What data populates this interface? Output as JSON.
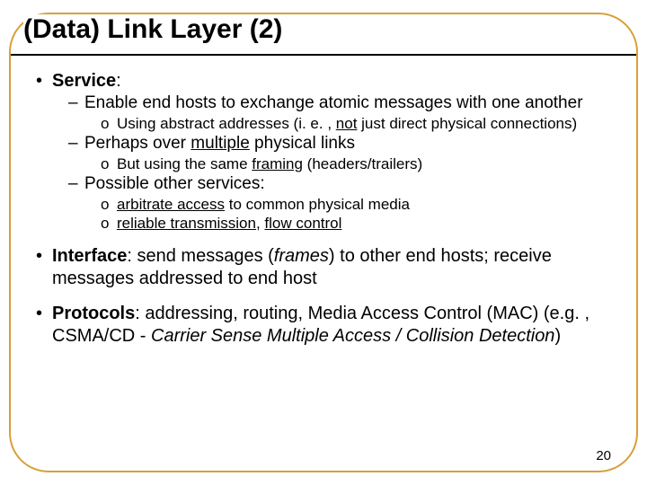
{
  "title": "(Data) Link Layer (2)",
  "bullets": {
    "service": {
      "lead": "Service",
      "tail": ":"
    },
    "s1": "Enable end hosts to exchange atomic messages with one another",
    "s1a_pre": "Using abstract addresses (i. e. , ",
    "s1a_not": "not",
    "s1a_post": " just direct physical connections)",
    "s2_pre": "Perhaps over ",
    "s2_u": "multiple",
    "s2_post": " physical links",
    "s2a_pre": "But using the same ",
    "s2a_u": "framing",
    "s2a_post": " (headers/trailers)",
    "s3": "Possible other services:",
    "s3a_u": "arbitrate access",
    "s3a_post": " to common physical media",
    "s3b_u1": "reliable transmission",
    "s3b_mid": ", ",
    "s3b_u2": "flow control",
    "iface_lead": "Interface",
    "iface_text1": ": send messages (",
    "iface_i": "frames",
    "iface_text2": ") to other end hosts; receive messages addressed to end host",
    "proto_lead": "Protocols",
    "proto_text1": ": addressing, routing, Media Access Control (MAC) (e.g. , CSMA/CD - ",
    "proto_i": "Carrier Sense Multiple Access / Collision Detection",
    "proto_text2": ")"
  },
  "marks": {
    "bullet": "•",
    "dash": "–",
    "circ": "o"
  },
  "slidenum": "20"
}
